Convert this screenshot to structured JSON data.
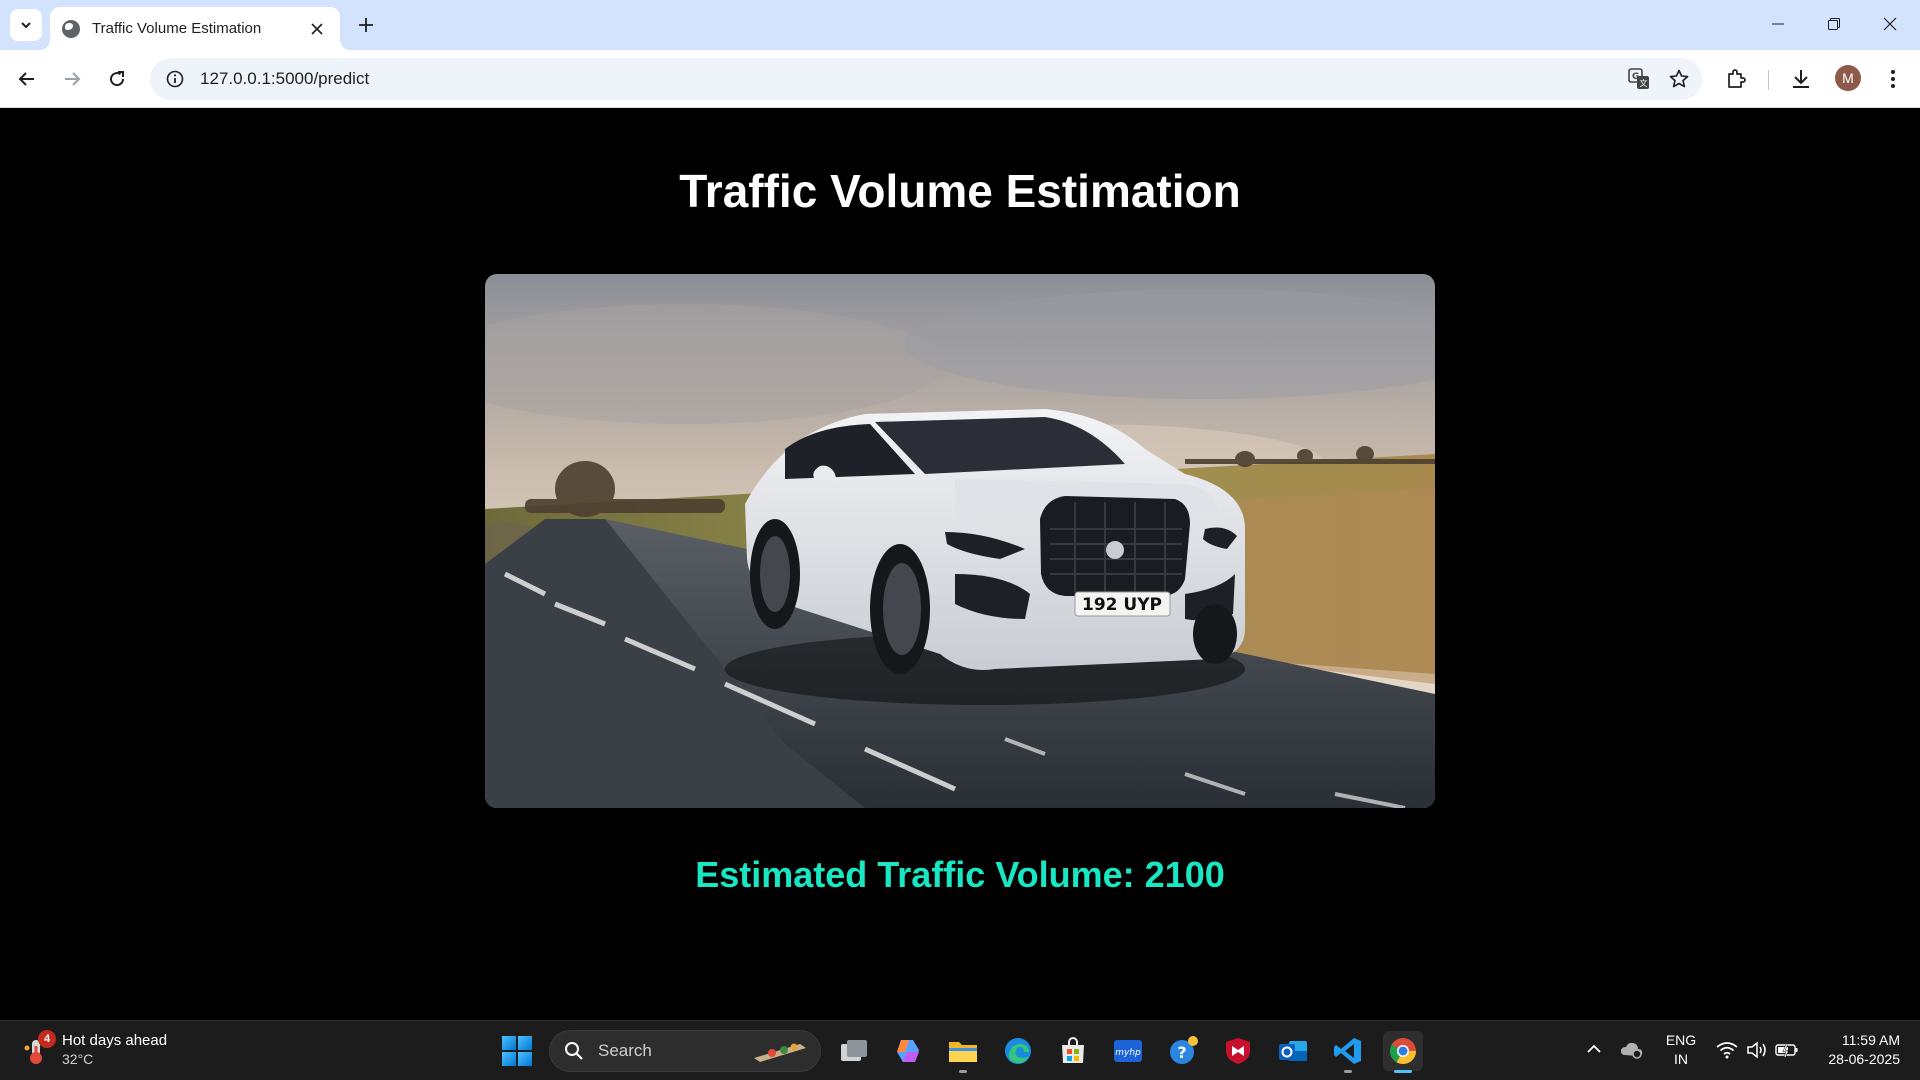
{
  "browser": {
    "tab_title": "Traffic Volume Estimation",
    "url": "127.0.0.1:5000/predict",
    "profile_initial": "M"
  },
  "page": {
    "title": "Traffic Volume Estimation",
    "hero_image_alt": "White sedan driving on a country road",
    "plate_text": "192 UYP",
    "result_text": "Estimated Traffic Volume: 2100",
    "result_color": "#19e6c2"
  },
  "taskbar": {
    "weather_title": "Hot days ahead",
    "weather_temp": "32°C",
    "weather_badge": "4",
    "search_placeholder": "Search",
    "language_line1": "ENG",
    "language_line2": "IN",
    "time": "11:59 AM",
    "date": "28-06-2025"
  }
}
